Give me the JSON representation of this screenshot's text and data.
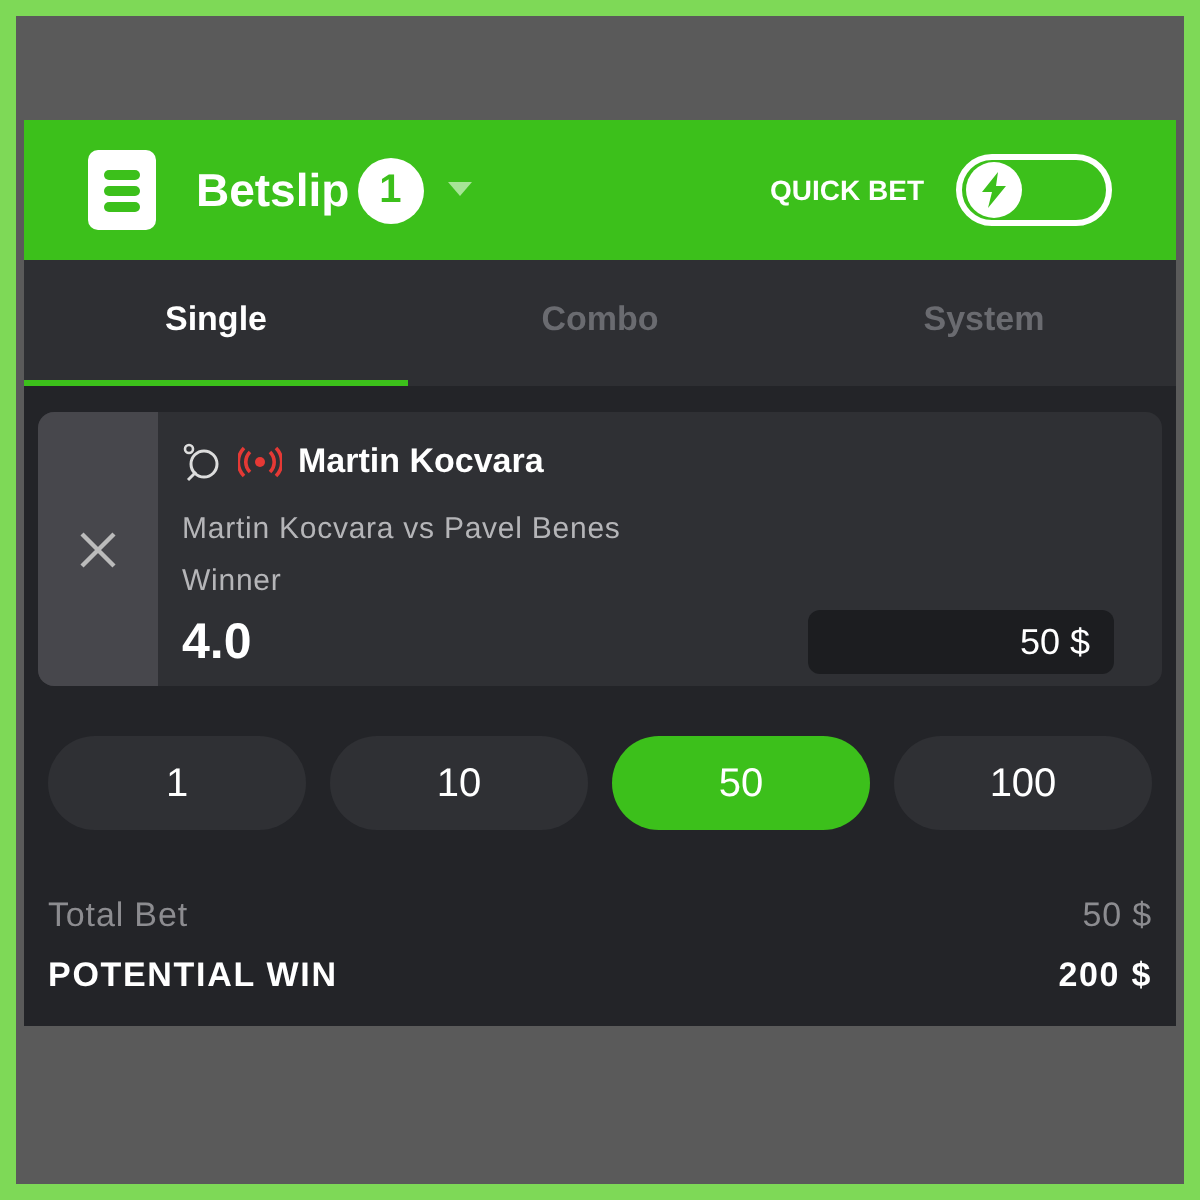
{
  "header": {
    "title": "Betslip",
    "count": "1",
    "quick_bet": {
      "label": "QUICK BET",
      "on": false
    }
  },
  "tabs": [
    {
      "label": "Single",
      "selected": true
    },
    {
      "label": "Combo",
      "selected": false
    },
    {
      "label": "System",
      "selected": false
    }
  ],
  "bet": {
    "live": true,
    "player": "Martin Kocvara",
    "match": "Martin Kocvara vs Pavel Benes",
    "market": "Winner",
    "odds": "4.0",
    "stake": "50 $"
  },
  "chips": [
    {
      "label": "1",
      "selected": false
    },
    {
      "label": "10",
      "selected": false
    },
    {
      "label": "50",
      "selected": true
    },
    {
      "label": "100",
      "selected": false
    }
  ],
  "summary": {
    "total_label": "Total Bet",
    "total": "50 $",
    "win_label": "POTENTIAL WIN",
    "win": "200 $"
  }
}
